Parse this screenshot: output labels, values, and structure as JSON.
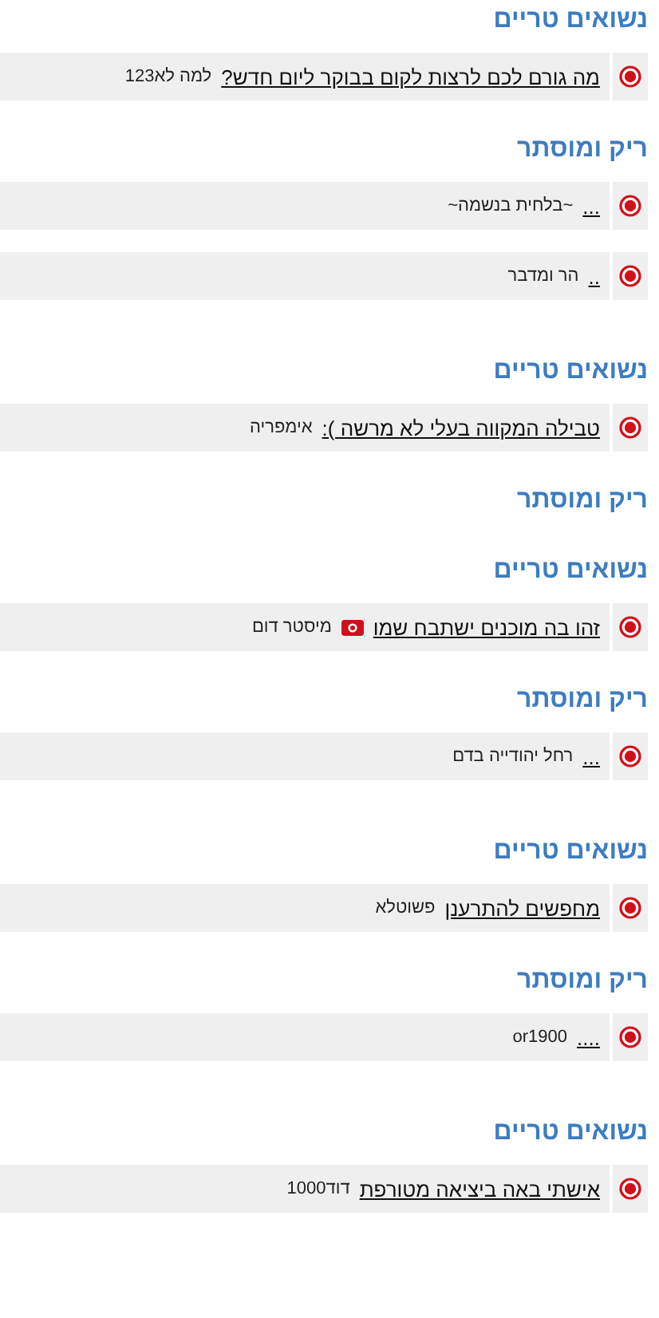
{
  "sections": [
    {
      "title": "נשואים טריים",
      "kind": "fresh",
      "rows": [
        {
          "title": "מה גורם לכם לרצות לקום בבוקר ליום חדש?",
          "author": "למה לא123",
          "has_image": false
        }
      ]
    },
    {
      "title": "ריק ומוסתר",
      "kind": "hidden",
      "rows": [
        {
          "title": "...",
          "author": "~בלחית בנשמה~",
          "has_image": false
        },
        {
          "title": "..",
          "author": "הר ומדבר",
          "has_image": false
        }
      ]
    },
    {
      "title": "נשואים טריים",
      "kind": "fresh",
      "rows": [
        {
          "title": "טבילה המקווה בעלי לא מרשה ):",
          "author": "אימפריה",
          "has_image": false
        }
      ]
    },
    {
      "title": "ריק ומוסתר",
      "kind": "hidden"
    },
    {
      "title": "נשואים טריים",
      "kind": "fresh",
      "rows": [
        {
          "title": "זהו בה מוכנים ישתבח שמו",
          "author": "מיסטר דום",
          "has_image": true
        }
      ]
    },
    {
      "title": "ריק ומוסתר",
      "kind": "hidden",
      "rows": [
        {
          "title": "...",
          "author": "רחל יהודייה בדם",
          "has_image": false
        }
      ]
    },
    {
      "title": "נשואים טריים",
      "kind": "fresh",
      "rows": [
        {
          "title": "מחפשים להתרענן",
          "author": "פשוטלא",
          "has_image": false
        }
      ]
    },
    {
      "title": "ריק ומוסתר",
      "kind": "hidden",
      "rows": [
        {
          "title": "....",
          "author": "or1900",
          "has_image": false
        }
      ]
    },
    {
      "title": "נשואים טריים",
      "kind": "fresh",
      "rows": [
        {
          "title": "אישתי באה ביציאה מטורפת",
          "author": "דוד1000",
          "has_image": false
        }
      ]
    }
  ]
}
